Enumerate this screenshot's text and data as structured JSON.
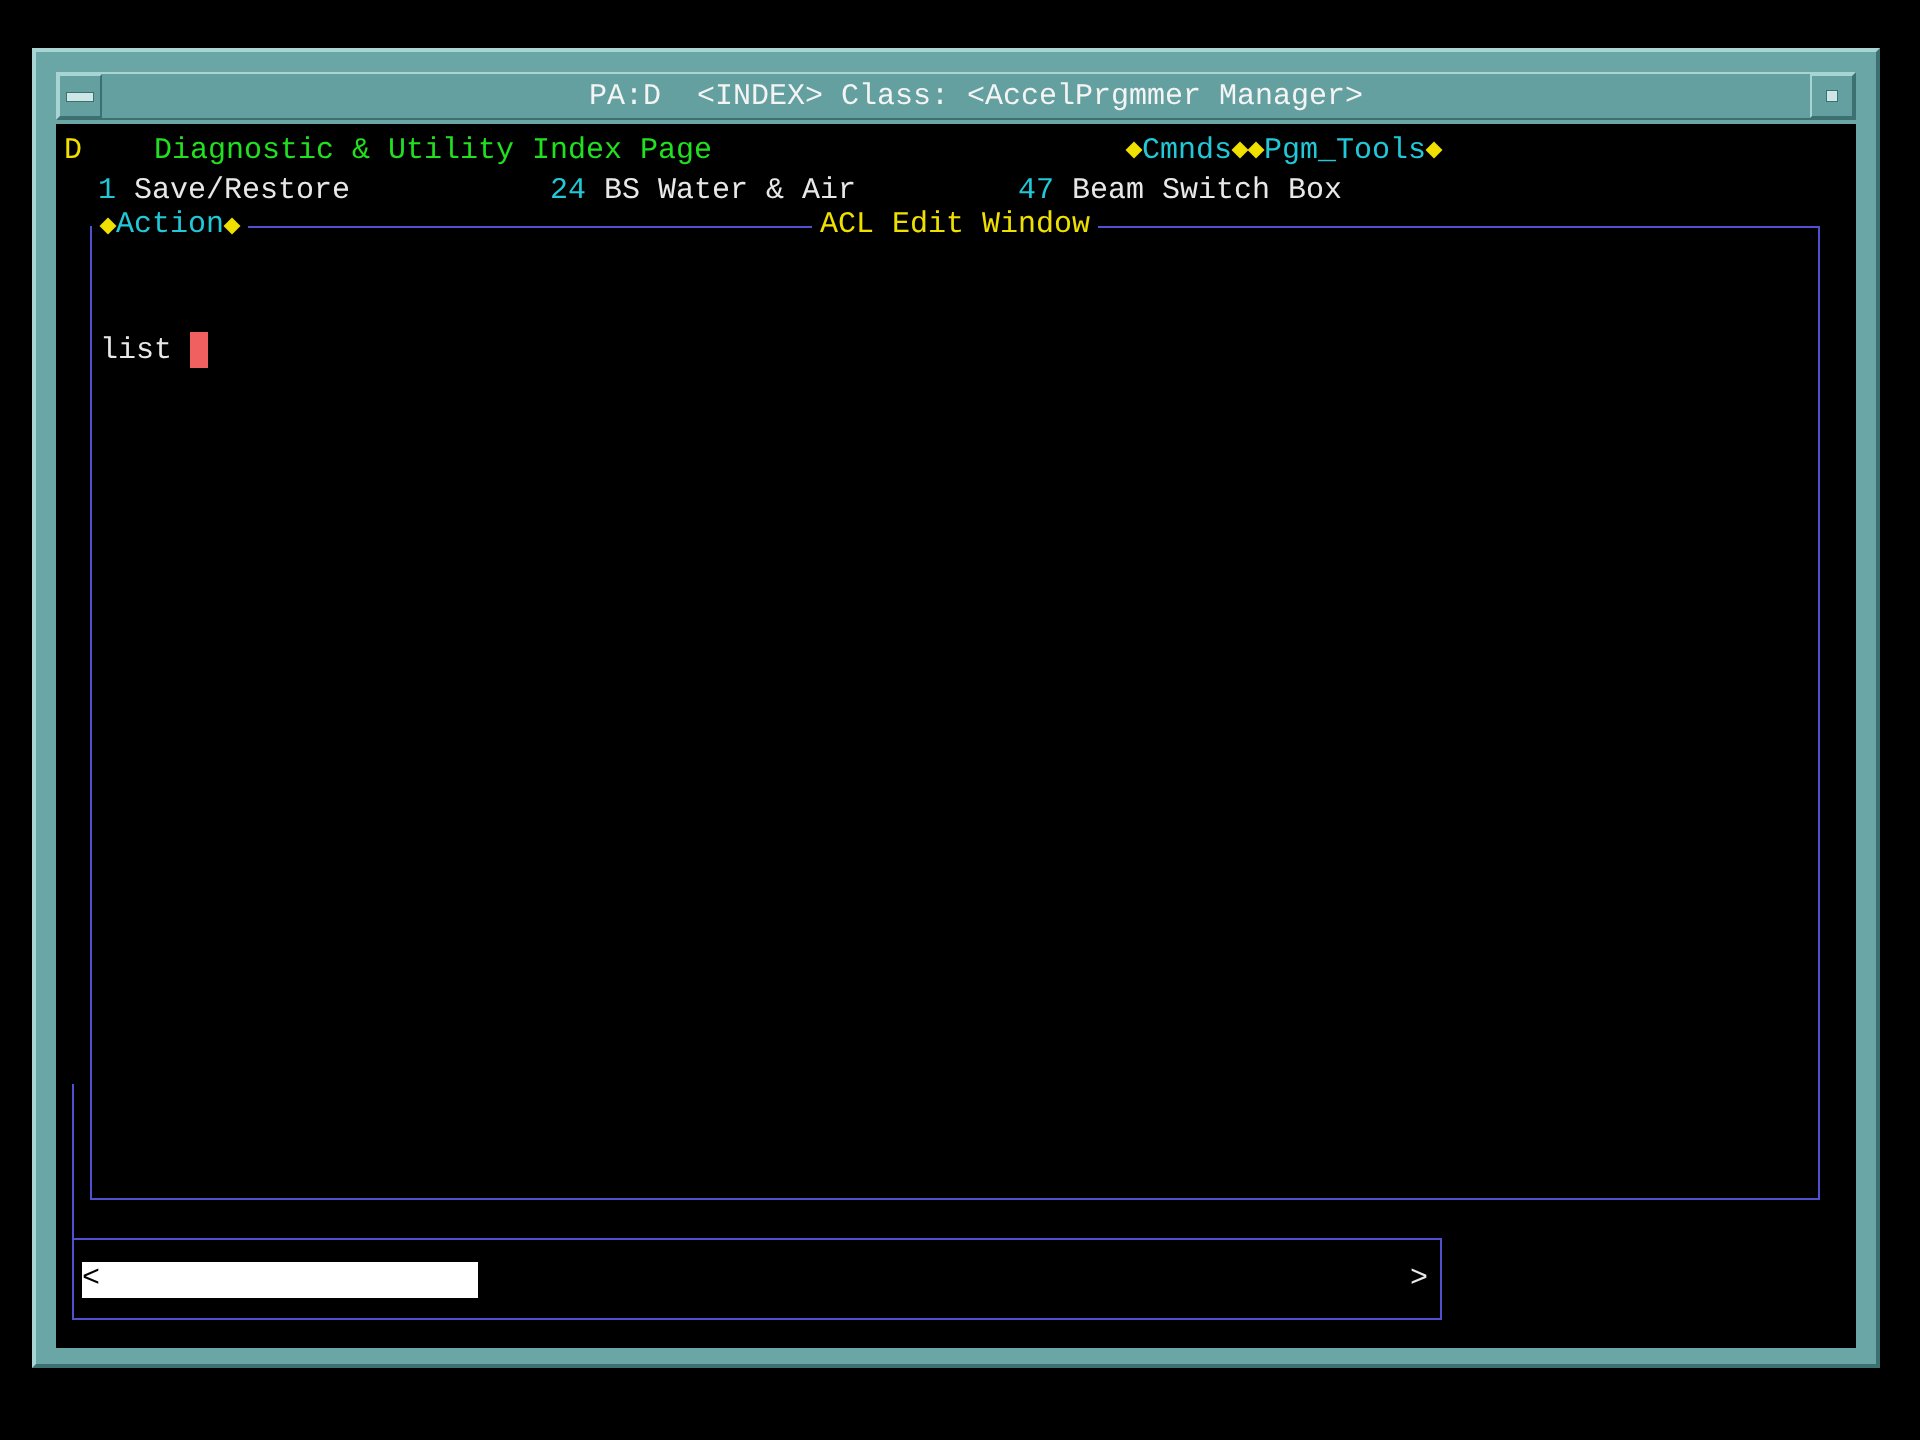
{
  "window": {
    "title": "PA:D  <INDEX> Class: <AccelPrgmmer Manager>"
  },
  "header": {
    "page_letter": "D",
    "title": "Diagnostic & Utility Index Page",
    "menus": [
      {
        "label": "Cmnds"
      },
      {
        "label": "Pgm_Tools"
      }
    ]
  },
  "pages": [
    {
      "number": "1",
      "label": "Save/Restore"
    },
    {
      "number": "24",
      "label": "BS Water & Air"
    },
    {
      "number": "47",
      "label": "Beam Switch Box"
    }
  ],
  "edit_window": {
    "title": "ACL Edit Window",
    "menu": "Action",
    "lines": [
      "list"
    ],
    "cursor": true
  },
  "scrollbar": {
    "left": "<",
    "right": ">"
  }
}
